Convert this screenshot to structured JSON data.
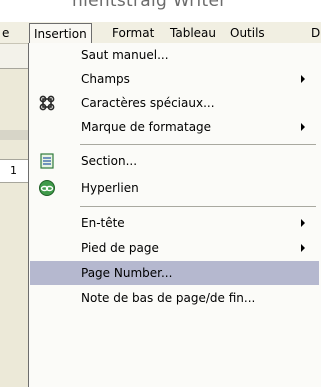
{
  "window": {
    "title_fragment": "hientstraig Writer"
  },
  "menubar": {
    "items": [
      {
        "label": "e"
      },
      {
        "label": "Insertion"
      },
      {
        "label": "Format"
      },
      {
        "label": "Tableau"
      },
      {
        "label": "Outils"
      },
      {
        "label": "D"
      }
    ]
  },
  "background": {
    "ruler_number": "1"
  },
  "insert_menu": {
    "items": [
      {
        "label": "Saut manuel...",
        "submenu": false
      },
      {
        "label": "Champs",
        "submenu": true
      },
      {
        "label": "Caractères spéciaux...",
        "submenu": false,
        "icon": "command-key-icon"
      },
      {
        "label": "Marque de formatage",
        "submenu": true
      },
      {
        "label": "Section...",
        "submenu": false,
        "icon": "section-icon"
      },
      {
        "label": "Hyperlien",
        "submenu": false,
        "icon": "hyperlink-icon"
      },
      {
        "label": "En-tête",
        "submenu": true
      },
      {
        "label": "Pied de page",
        "submenu": true
      },
      {
        "label": "Page Number...",
        "submenu": false,
        "highlighted": true
      },
      {
        "label": "Note de bas de page/de fin...",
        "submenu": false
      }
    ],
    "highlight_color": "#b5b8cf"
  }
}
